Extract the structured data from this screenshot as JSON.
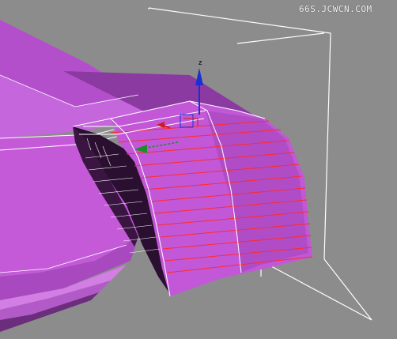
{
  "viewport": {
    "background_color": "#8c8c8c",
    "watermark": "66S.JCWCN.COM"
  },
  "gizmo": {
    "z_label": "z",
    "x_color": "#d11b1b",
    "y_color": "#1a8f2a",
    "z_color": "#1b2fd6"
  },
  "mesh": {
    "face_color": "#c258d7",
    "dark_face_color": "#2a0f30",
    "selected_edge_color": "#ff2a2a",
    "edge_color": "#ffffff"
  }
}
